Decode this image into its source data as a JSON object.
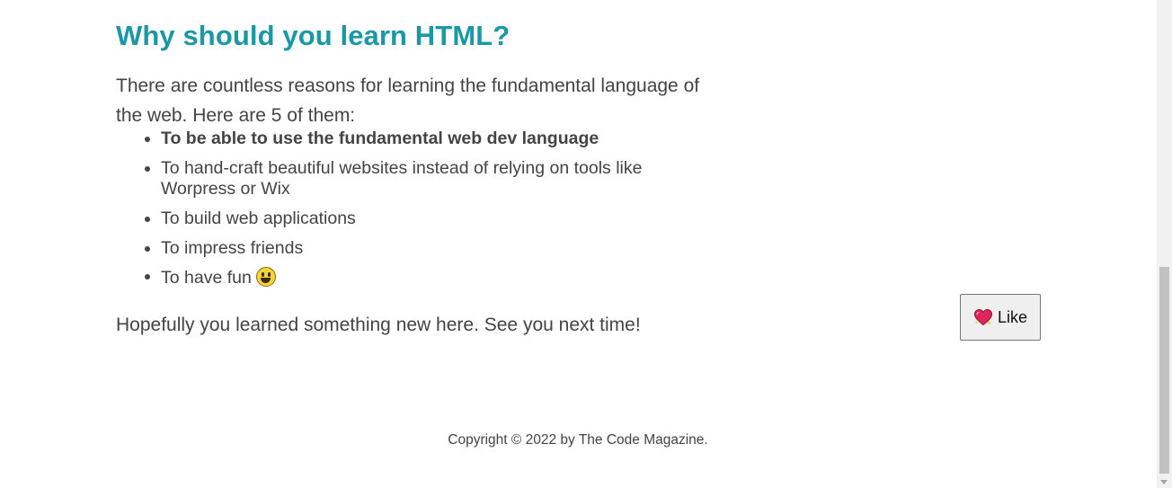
{
  "article": {
    "heading": "Why should you learn HTML?",
    "intro": "There are countless reasons for learning the fundamental language of the web. Here are 5 of them:",
    "reasons": [
      "To be able to use the fundamental web dev language",
      "To hand-craft beautiful websites instead of relying on tools like Worpress or Wix",
      "To build web applications",
      "To impress friends",
      "To have fun"
    ],
    "reason_emphasis_index": 0,
    "last_reason_emoji": "smiley-face-icon",
    "closing": "Hopefully you learned something new here. See you next time!"
  },
  "like_button": {
    "label": "Like",
    "icon": "sparkling-heart-icon"
  },
  "footer": {
    "copyright": "Copyright © 2022 by The Code Magazine."
  },
  "colors": {
    "heading": "#1a98a6",
    "body_text": "#444444",
    "background": "#ffffff",
    "button_background": "#efefef",
    "heart": "#e0245e"
  }
}
